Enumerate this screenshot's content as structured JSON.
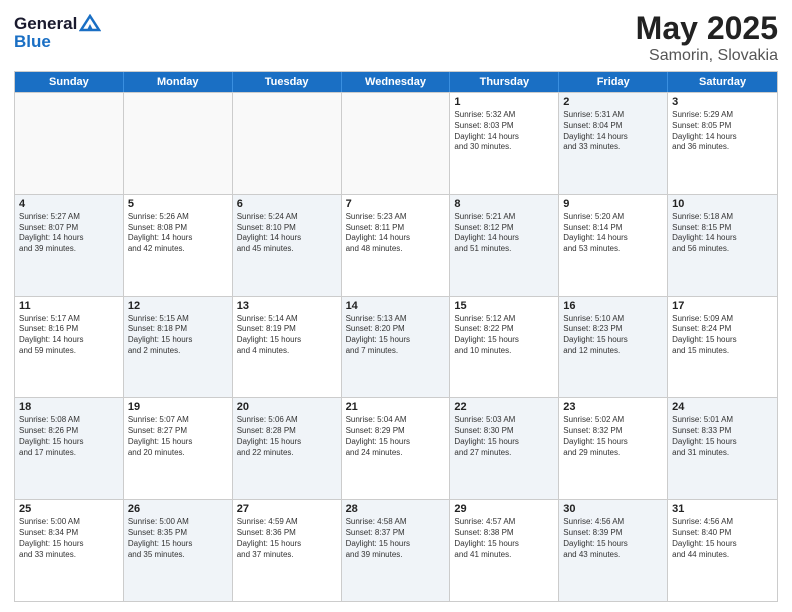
{
  "header": {
    "logo_general": "General",
    "logo_blue": "Blue",
    "main_title": "May 2025",
    "sub_title": "Samorin, Slovakia"
  },
  "calendar": {
    "days": [
      "Sunday",
      "Monday",
      "Tuesday",
      "Wednesday",
      "Thursday",
      "Friday",
      "Saturday"
    ],
    "rows": [
      [
        {
          "day": "",
          "empty": true
        },
        {
          "day": "",
          "empty": true
        },
        {
          "day": "",
          "empty": true
        },
        {
          "day": "",
          "empty": true
        },
        {
          "day": "1",
          "shaded": false,
          "lines": [
            "Sunrise: 5:32 AM",
            "Sunset: 8:03 PM",
            "Daylight: 14 hours",
            "and 30 minutes."
          ]
        },
        {
          "day": "2",
          "shaded": true,
          "lines": [
            "Sunrise: 5:31 AM",
            "Sunset: 8:04 PM",
            "Daylight: 14 hours",
            "and 33 minutes."
          ]
        },
        {
          "day": "3",
          "shaded": false,
          "lines": [
            "Sunrise: 5:29 AM",
            "Sunset: 8:05 PM",
            "Daylight: 14 hours",
            "and 36 minutes."
          ]
        }
      ],
      [
        {
          "day": "4",
          "shaded": true,
          "lines": [
            "Sunrise: 5:27 AM",
            "Sunset: 8:07 PM",
            "Daylight: 14 hours",
            "and 39 minutes."
          ]
        },
        {
          "day": "5",
          "shaded": false,
          "lines": [
            "Sunrise: 5:26 AM",
            "Sunset: 8:08 PM",
            "Daylight: 14 hours",
            "and 42 minutes."
          ]
        },
        {
          "day": "6",
          "shaded": true,
          "lines": [
            "Sunrise: 5:24 AM",
            "Sunset: 8:10 PM",
            "Daylight: 14 hours",
            "and 45 minutes."
          ]
        },
        {
          "day": "7",
          "shaded": false,
          "lines": [
            "Sunrise: 5:23 AM",
            "Sunset: 8:11 PM",
            "Daylight: 14 hours",
            "and 48 minutes."
          ]
        },
        {
          "day": "8",
          "shaded": true,
          "lines": [
            "Sunrise: 5:21 AM",
            "Sunset: 8:12 PM",
            "Daylight: 14 hours",
            "and 51 minutes."
          ]
        },
        {
          "day": "9",
          "shaded": false,
          "lines": [
            "Sunrise: 5:20 AM",
            "Sunset: 8:14 PM",
            "Daylight: 14 hours",
            "and 53 minutes."
          ]
        },
        {
          "day": "10",
          "shaded": true,
          "lines": [
            "Sunrise: 5:18 AM",
            "Sunset: 8:15 PM",
            "Daylight: 14 hours",
            "and 56 minutes."
          ]
        }
      ],
      [
        {
          "day": "11",
          "shaded": false,
          "lines": [
            "Sunrise: 5:17 AM",
            "Sunset: 8:16 PM",
            "Daylight: 14 hours",
            "and 59 minutes."
          ]
        },
        {
          "day": "12",
          "shaded": true,
          "lines": [
            "Sunrise: 5:15 AM",
            "Sunset: 8:18 PM",
            "Daylight: 15 hours",
            "and 2 minutes."
          ]
        },
        {
          "day": "13",
          "shaded": false,
          "lines": [
            "Sunrise: 5:14 AM",
            "Sunset: 8:19 PM",
            "Daylight: 15 hours",
            "and 4 minutes."
          ]
        },
        {
          "day": "14",
          "shaded": true,
          "lines": [
            "Sunrise: 5:13 AM",
            "Sunset: 8:20 PM",
            "Daylight: 15 hours",
            "and 7 minutes."
          ]
        },
        {
          "day": "15",
          "shaded": false,
          "lines": [
            "Sunrise: 5:12 AM",
            "Sunset: 8:22 PM",
            "Daylight: 15 hours",
            "and 10 minutes."
          ]
        },
        {
          "day": "16",
          "shaded": true,
          "lines": [
            "Sunrise: 5:10 AM",
            "Sunset: 8:23 PM",
            "Daylight: 15 hours",
            "and 12 minutes."
          ]
        },
        {
          "day": "17",
          "shaded": false,
          "lines": [
            "Sunrise: 5:09 AM",
            "Sunset: 8:24 PM",
            "Daylight: 15 hours",
            "and 15 minutes."
          ]
        }
      ],
      [
        {
          "day": "18",
          "shaded": true,
          "lines": [
            "Sunrise: 5:08 AM",
            "Sunset: 8:26 PM",
            "Daylight: 15 hours",
            "and 17 minutes."
          ]
        },
        {
          "day": "19",
          "shaded": false,
          "lines": [
            "Sunrise: 5:07 AM",
            "Sunset: 8:27 PM",
            "Daylight: 15 hours",
            "and 20 minutes."
          ]
        },
        {
          "day": "20",
          "shaded": true,
          "lines": [
            "Sunrise: 5:06 AM",
            "Sunset: 8:28 PM",
            "Daylight: 15 hours",
            "and 22 minutes."
          ]
        },
        {
          "day": "21",
          "shaded": false,
          "lines": [
            "Sunrise: 5:04 AM",
            "Sunset: 8:29 PM",
            "Daylight: 15 hours",
            "and 24 minutes."
          ]
        },
        {
          "day": "22",
          "shaded": true,
          "lines": [
            "Sunrise: 5:03 AM",
            "Sunset: 8:30 PM",
            "Daylight: 15 hours",
            "and 27 minutes."
          ]
        },
        {
          "day": "23",
          "shaded": false,
          "lines": [
            "Sunrise: 5:02 AM",
            "Sunset: 8:32 PM",
            "Daylight: 15 hours",
            "and 29 minutes."
          ]
        },
        {
          "day": "24",
          "shaded": true,
          "lines": [
            "Sunrise: 5:01 AM",
            "Sunset: 8:33 PM",
            "Daylight: 15 hours",
            "and 31 minutes."
          ]
        }
      ],
      [
        {
          "day": "25",
          "shaded": false,
          "lines": [
            "Sunrise: 5:00 AM",
            "Sunset: 8:34 PM",
            "Daylight: 15 hours",
            "and 33 minutes."
          ]
        },
        {
          "day": "26",
          "shaded": true,
          "lines": [
            "Sunrise: 5:00 AM",
            "Sunset: 8:35 PM",
            "Daylight: 15 hours",
            "and 35 minutes."
          ]
        },
        {
          "day": "27",
          "shaded": false,
          "lines": [
            "Sunrise: 4:59 AM",
            "Sunset: 8:36 PM",
            "Daylight: 15 hours",
            "and 37 minutes."
          ]
        },
        {
          "day": "28",
          "shaded": true,
          "lines": [
            "Sunrise: 4:58 AM",
            "Sunset: 8:37 PM",
            "Daylight: 15 hours",
            "and 39 minutes."
          ]
        },
        {
          "day": "29",
          "shaded": false,
          "lines": [
            "Sunrise: 4:57 AM",
            "Sunset: 8:38 PM",
            "Daylight: 15 hours",
            "and 41 minutes."
          ]
        },
        {
          "day": "30",
          "shaded": true,
          "lines": [
            "Sunrise: 4:56 AM",
            "Sunset: 8:39 PM",
            "Daylight: 15 hours",
            "and 43 minutes."
          ]
        },
        {
          "day": "31",
          "shaded": false,
          "lines": [
            "Sunrise: 4:56 AM",
            "Sunset: 8:40 PM",
            "Daylight: 15 hours",
            "and 44 minutes."
          ]
        }
      ]
    ]
  }
}
